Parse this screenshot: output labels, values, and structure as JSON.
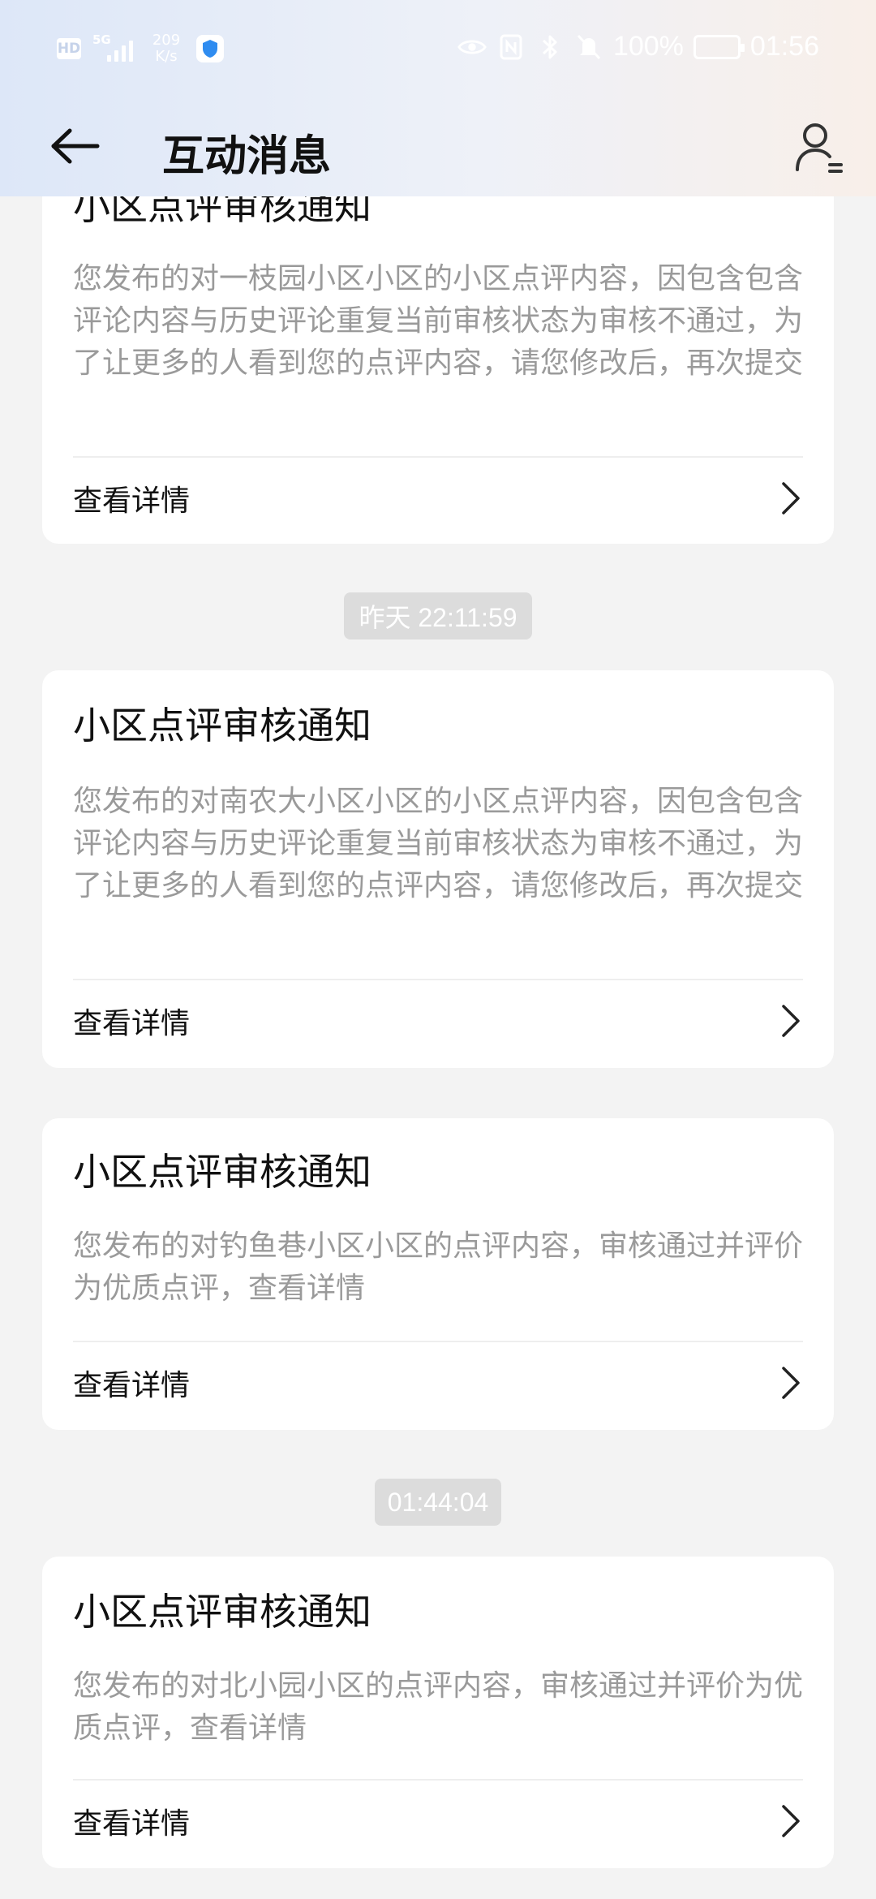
{
  "status_bar": {
    "hd": "HD",
    "network": "5G",
    "speed_value": "209",
    "speed_unit": "K/s",
    "battery": "100%",
    "time": "01:56"
  },
  "header": {
    "title": "互动消息"
  },
  "messages": [
    {
      "title": "小区点评审核通知",
      "body": "您发布的对一枝园小区小区的小区点评内容，因包含包含评论内容与历史评论重复当前审核状态为审核不通过，为了让更多的人看到您的点评内容，请您修改后，再次提交",
      "link_label": "查看详情"
    },
    {
      "timestamp": "昨天 22:11:59",
      "title": "小区点评审核通知",
      "body": "您发布的对南农大小区小区的小区点评内容，因包含包含评论内容与历史评论重复当前审核状态为审核不通过，为了让更多的人看到您的点评内容，请您修改后，再次提交",
      "link_label": "查看详情"
    },
    {
      "title": "小区点评审核通知",
      "body": "您发布的对钓鱼巷小区小区的点评内容，审核通过并评价为优质点评，查看详情",
      "link_label": "查看详情"
    },
    {
      "timestamp": "01:44:04",
      "title": "小区点评审核通知",
      "body": "您发布的对北小园小区的点评内容，审核通过并评价为优质点评，查看详情",
      "link_label": "查看详情"
    }
  ],
  "icons": {
    "back": "arrow-left-icon",
    "user": "user-settings-icon",
    "chevron": "chevron-right-icon"
  },
  "colors": {
    "background": "#f3f3f3",
    "card": "#ffffff",
    "title_text": "#111111",
    "body_text": "#9a9a9a",
    "timestamp_bg": "#dcdcdc"
  }
}
